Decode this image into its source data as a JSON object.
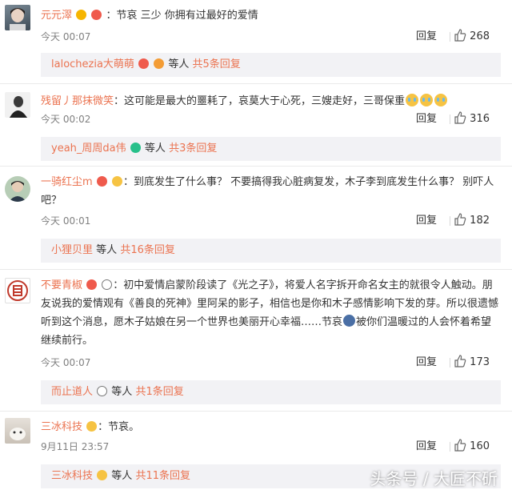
{
  "actions": {
    "reply_label": "回复"
  },
  "comments": [
    {
      "username": "元元濢",
      "text": "：节哀 三少 你拥有过最好的爱情",
      "time": "今天 00:07",
      "likes": "268",
      "thread": {
        "user": "lalochezia大萌萌",
        "suffix": "等人",
        "count_text": "共5条回复"
      }
    },
    {
      "username": "残留丿那抹微笑",
      "text": "：这可能是最大的噩耗了，哀莫大于心死，三嫂走好，三哥保重",
      "time": "今天 00:02",
      "likes": "316",
      "thread": {
        "user": "yeah_周周da伟",
        "suffix": "等人",
        "count_text": "共3条回复"
      }
    },
    {
      "username": "一骑红尘m",
      "text": "：到底发生了什么事？ 不要搞得我心脏病复发，木子李到底发生什么事？ 别吓人吧？",
      "time": "今天 00:01",
      "likes": "182",
      "thread": {
        "user": "小狸贝里",
        "suffix": "等人",
        "count_text": "共16条回复"
      }
    },
    {
      "username": "不要青椒",
      "text": "：初中爱情启蒙阶段读了《光之子》，将爱人名字拆开命名女主的就很令人触动。朋友说我的爱情观有《善良的死神》里阿呆的影子，相信也是你和木子感情影响下发的芽。所以很遗憾听到这个消息，愿木子姑娘在另一个世界也美丽开心幸福……节哀",
      "text_tail": "被你们温暖过的人会怀着希望继续前行。",
      "time": "今天 00:07",
      "likes": "173",
      "thread": {
        "user": "而止道人",
        "suffix": "等人",
        "count_text": "共1条回复"
      }
    },
    {
      "username": "三冰科技",
      "text": "：节哀。",
      "time": "9月11日 23:57",
      "likes": "160",
      "thread": {
        "user": "三冰科技",
        "suffix": "等人",
        "count_text": "共11条回复"
      }
    }
  ],
  "watermark": "头条号 / 大匠不斫",
  "colors": {
    "username": "#eb7350",
    "thread_bg": "#f2f2f5",
    "meta": "#808080"
  }
}
